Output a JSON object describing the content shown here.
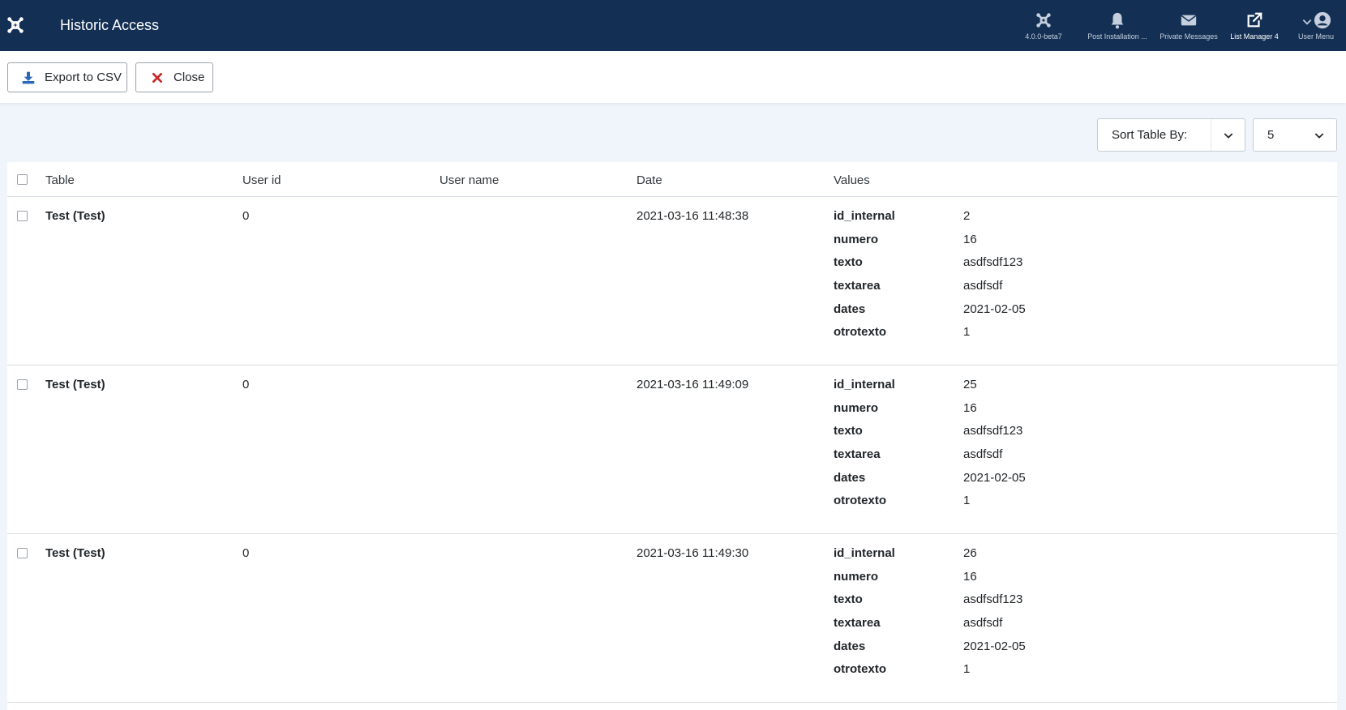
{
  "header": {
    "title": "Historic Access",
    "items": [
      {
        "label": "4.0.0-beta7",
        "icon": "joomla-icon"
      },
      {
        "label": "Post Installation ...",
        "icon": "bell-icon"
      },
      {
        "label": "Private Messages",
        "icon": "envelope-icon"
      },
      {
        "label": "List Manager 4",
        "icon": "external-link-icon"
      },
      {
        "label": "User Menu",
        "icon": "user-circle-icon"
      }
    ]
  },
  "toolbar": {
    "export_label": "Export to CSV",
    "close_label": "Close"
  },
  "filters": {
    "sort_label": "Sort Table By:",
    "limit_value": "5"
  },
  "table": {
    "columns": [
      "Table",
      "User id",
      "User name",
      "Date",
      "Values"
    ],
    "rows": [
      {
        "table": "Test (Test)",
        "user_id": "0",
        "user_name": "",
        "date": "2021-03-16 11:48:38",
        "values": [
          {
            "key": "id_internal",
            "value": "2"
          },
          {
            "key": "numero",
            "value": "16"
          },
          {
            "key": "texto",
            "value": "asdfsdf123"
          },
          {
            "key": "textarea",
            "value": "asdfsdf"
          },
          {
            "key": "dates",
            "value": "2021-02-05"
          },
          {
            "key": "otrotexto",
            "value": "1"
          }
        ]
      },
      {
        "table": "Test (Test)",
        "user_id": "0",
        "user_name": "",
        "date": "2021-03-16 11:49:09",
        "values": [
          {
            "key": "id_internal",
            "value": "25"
          },
          {
            "key": "numero",
            "value": "16"
          },
          {
            "key": "texto",
            "value": "asdfsdf123"
          },
          {
            "key": "textarea",
            "value": "asdfsdf"
          },
          {
            "key": "dates",
            "value": "2021-02-05"
          },
          {
            "key": "otrotexto",
            "value": "1"
          }
        ]
      },
      {
        "table": "Test (Test)",
        "user_id": "0",
        "user_name": "",
        "date": "2021-03-16 11:49:30",
        "values": [
          {
            "key": "id_internal",
            "value": "26"
          },
          {
            "key": "numero",
            "value": "16"
          },
          {
            "key": "texto",
            "value": "asdfsdf123"
          },
          {
            "key": "textarea",
            "value": "asdfsdf"
          },
          {
            "key": "dates",
            "value": "2021-02-05"
          },
          {
            "key": "otrotexto",
            "value": "1"
          }
        ]
      }
    ]
  },
  "colors": {
    "header_bg": "#132f53",
    "page_bg": "#f0f4fb",
    "export_icon": "#2a69b8",
    "close_icon": "#c52827"
  }
}
